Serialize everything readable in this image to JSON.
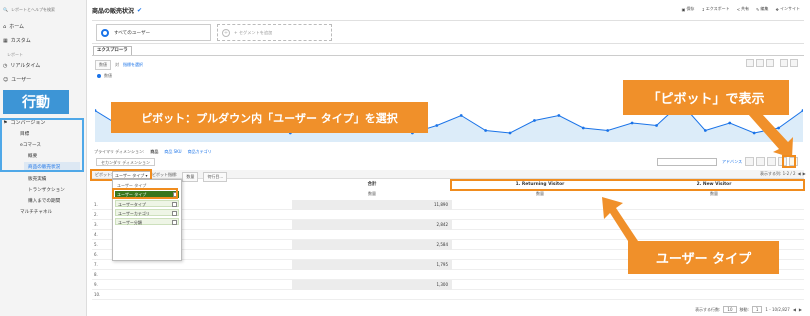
{
  "sidebar": {
    "search_placeholder": "レポートとヘルプを検索",
    "home": "ホーム",
    "custom": "カスタム",
    "reports_section": "レポート",
    "realtime": "リアルタイム",
    "user": "ユーザー",
    "conversion": "コンバージョン",
    "goals": "目標",
    "ecommerce": "eコマース",
    "overview": "概要",
    "product_sales": "商品の販売状況",
    "sales_performance": "販売実績",
    "transactions": "トランザクション",
    "time_to_purchase": "購入までの期間",
    "multichannel": "マルチチャネル"
  },
  "header": {
    "title": "商品の販売状況",
    "actions": [
      "保存",
      "エクスポート",
      "共有",
      "編集",
      "インサイト"
    ]
  },
  "segments": {
    "all_users": "すべてのユーザー",
    "add_segment": "+ セグメントを追加"
  },
  "tabs": {
    "explorer": "エクスプローラ"
  },
  "controls": {
    "metric_select": "数値",
    "vs": "対",
    "compare": "指標を選択",
    "legend": "数値"
  },
  "dimensions": {
    "primary_label": "プライマリ ディメンション:",
    "primary_items": [
      "商品",
      "商品 SKU",
      "商品カテゴリ"
    ],
    "secondary": "セカンダリ ディメンション",
    "advanced": "アドバンス"
  },
  "pivot": {
    "label": "ピボット:",
    "select": "ユーザー タイプ",
    "pivot_metric": "ピボット指標:",
    "metric": "数量",
    "extra": "何行目...",
    "row_info": "表示する列: 1-2 / 2",
    "dropdown": [
      "ユーザー タイプ",
      "ユーザータイプ",
      "ユーザーカテゴリ",
      "ユーザー分類"
    ]
  },
  "table": {
    "total_header": "合計",
    "col1_header": "1. Returning Visitor",
    "col2_header": "2. New Visitor",
    "metric_label": "数量",
    "rows": [
      {
        "n": "1.",
        "total": "11,890"
      },
      {
        "n": "2.",
        "total": ""
      },
      {
        "n": "3.",
        "total": "2,842"
      },
      {
        "n": "4.",
        "total": ""
      },
      {
        "n": "5.",
        "total": "2,584"
      },
      {
        "n": "6.",
        "total": ""
      },
      {
        "n": "7.",
        "total": "1,795"
      },
      {
        "n": "8.",
        "total": ""
      },
      {
        "n": "9.",
        "total": "1,300"
      },
      {
        "n": "10.",
        "total": ""
      }
    ]
  },
  "footer": {
    "rows_label": "表示する行数:",
    "rows_value": "10",
    "goto": "移動:",
    "goto_value": "1",
    "range": "1 - 10/2,827"
  },
  "callouts": {
    "behavior": "行動",
    "pivot_instruction": "ピボット：プルダウン内「ユーザー タイプ」を選択",
    "pivot_display": "「ピボット」で表示",
    "user_type": "ユーザー タイプ"
  },
  "colors": {
    "accent": "#f0902a",
    "blue": "#1a73e8"
  },
  "chart_series": [
    0.55,
    0.25,
    0.35,
    0.25,
    0.2,
    0.3,
    0.15,
    0.6,
    0.1,
    0.35,
    0.25,
    0.2,
    0.3,
    0.1,
    0.25,
    0.45,
    0.15,
    0.1,
    0.35,
    0.45,
    0.2,
    0.15,
    0.3,
    0.25,
    0.7,
    0.15,
    0.3,
    0.1,
    0.2,
    0.55
  ]
}
